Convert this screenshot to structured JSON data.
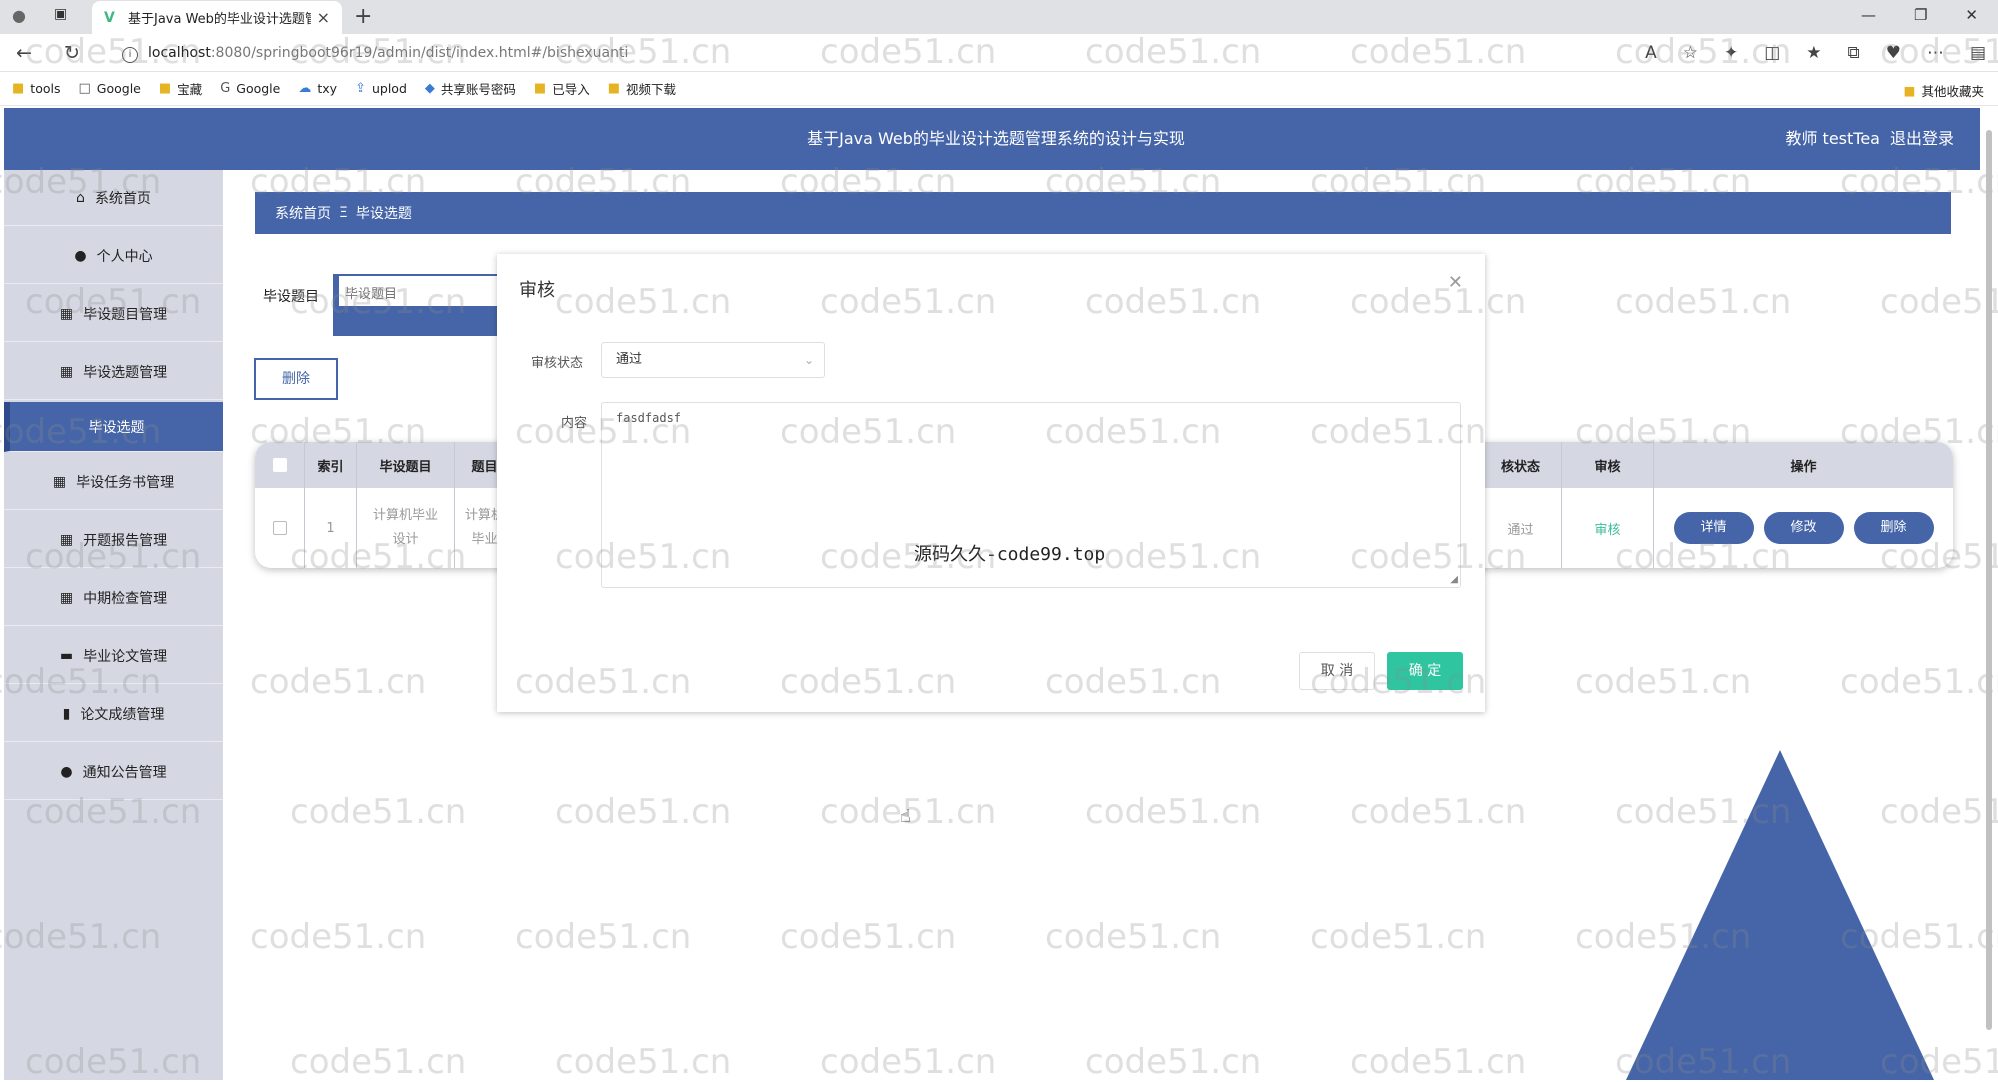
{
  "browser": {
    "tab_title": "基于Java Web的毕业设计选题管",
    "url_host": "localhost",
    "url_rest": ":8080/springboot96r19/admin/dist/index.html#/bishexuanti",
    "bookmarks": [
      "tools",
      "Google",
      "宝藏",
      "Google",
      "txy",
      "uplod",
      "共享账号密码",
      "已导入",
      "视频下载"
    ],
    "bookmarks_right": "其他收藏夹"
  },
  "header": {
    "title": "基于Java Web的毕业设计选题管理系统的设计与实现",
    "user": "教师 testTea",
    "logout": "退出登录"
  },
  "sidebar": {
    "items": [
      {
        "label": "系统首页",
        "icon": "home-icon"
      },
      {
        "label": "个人中心",
        "icon": "user-icon"
      },
      {
        "label": "毕设题目管理",
        "icon": "grid-icon"
      },
      {
        "label": "毕设选题管理",
        "icon": "grid-icon"
      },
      {
        "label": "毕设选题",
        "icon": ""
      },
      {
        "label": "毕设任务书管理",
        "icon": "grid-icon"
      },
      {
        "label": "开题报告管理",
        "icon": "grid-icon"
      },
      {
        "label": "中期检查管理",
        "icon": "grid-icon"
      },
      {
        "label": "毕业论文管理",
        "icon": "briefcase-icon"
      },
      {
        "label": "论文成绩管理",
        "icon": "bar-chart-icon"
      },
      {
        "label": "通知公告管理",
        "icon": "user-icon"
      }
    ]
  },
  "breadcrumb": {
    "home": "系统首页",
    "sep": "Ξ",
    "current": "毕设选题"
  },
  "search": {
    "label": "毕设题目",
    "placeholder": "毕设题目"
  },
  "toolbar": {
    "delete_label": "删除"
  },
  "table": {
    "headers": {
      "index": "索引",
      "topic": "毕设题目",
      "type": "题目",
      "status": "核状态",
      "audit": "审核",
      "ops": "操作"
    },
    "row": {
      "index": "1",
      "topic": "计算机毕业设计",
      "type": "计算机毕业",
      "status": "通过",
      "audit": "审核",
      "detail": "详情",
      "edit": "修改",
      "delete": "删除"
    }
  },
  "dialog": {
    "title": "审核",
    "status_label": "审核状态",
    "status_value": "通过",
    "content_label": "内容",
    "content_value": "fasdfadsf",
    "cancel": "取 消",
    "confirm": "确 定"
  },
  "overlay_text": "源码久久-code99.top",
  "watermark": "code51.cn",
  "colors": {
    "primary": "#4565a8",
    "sidebar_bg": "#d5d8e2",
    "confirm": "#2ec5a0"
  }
}
